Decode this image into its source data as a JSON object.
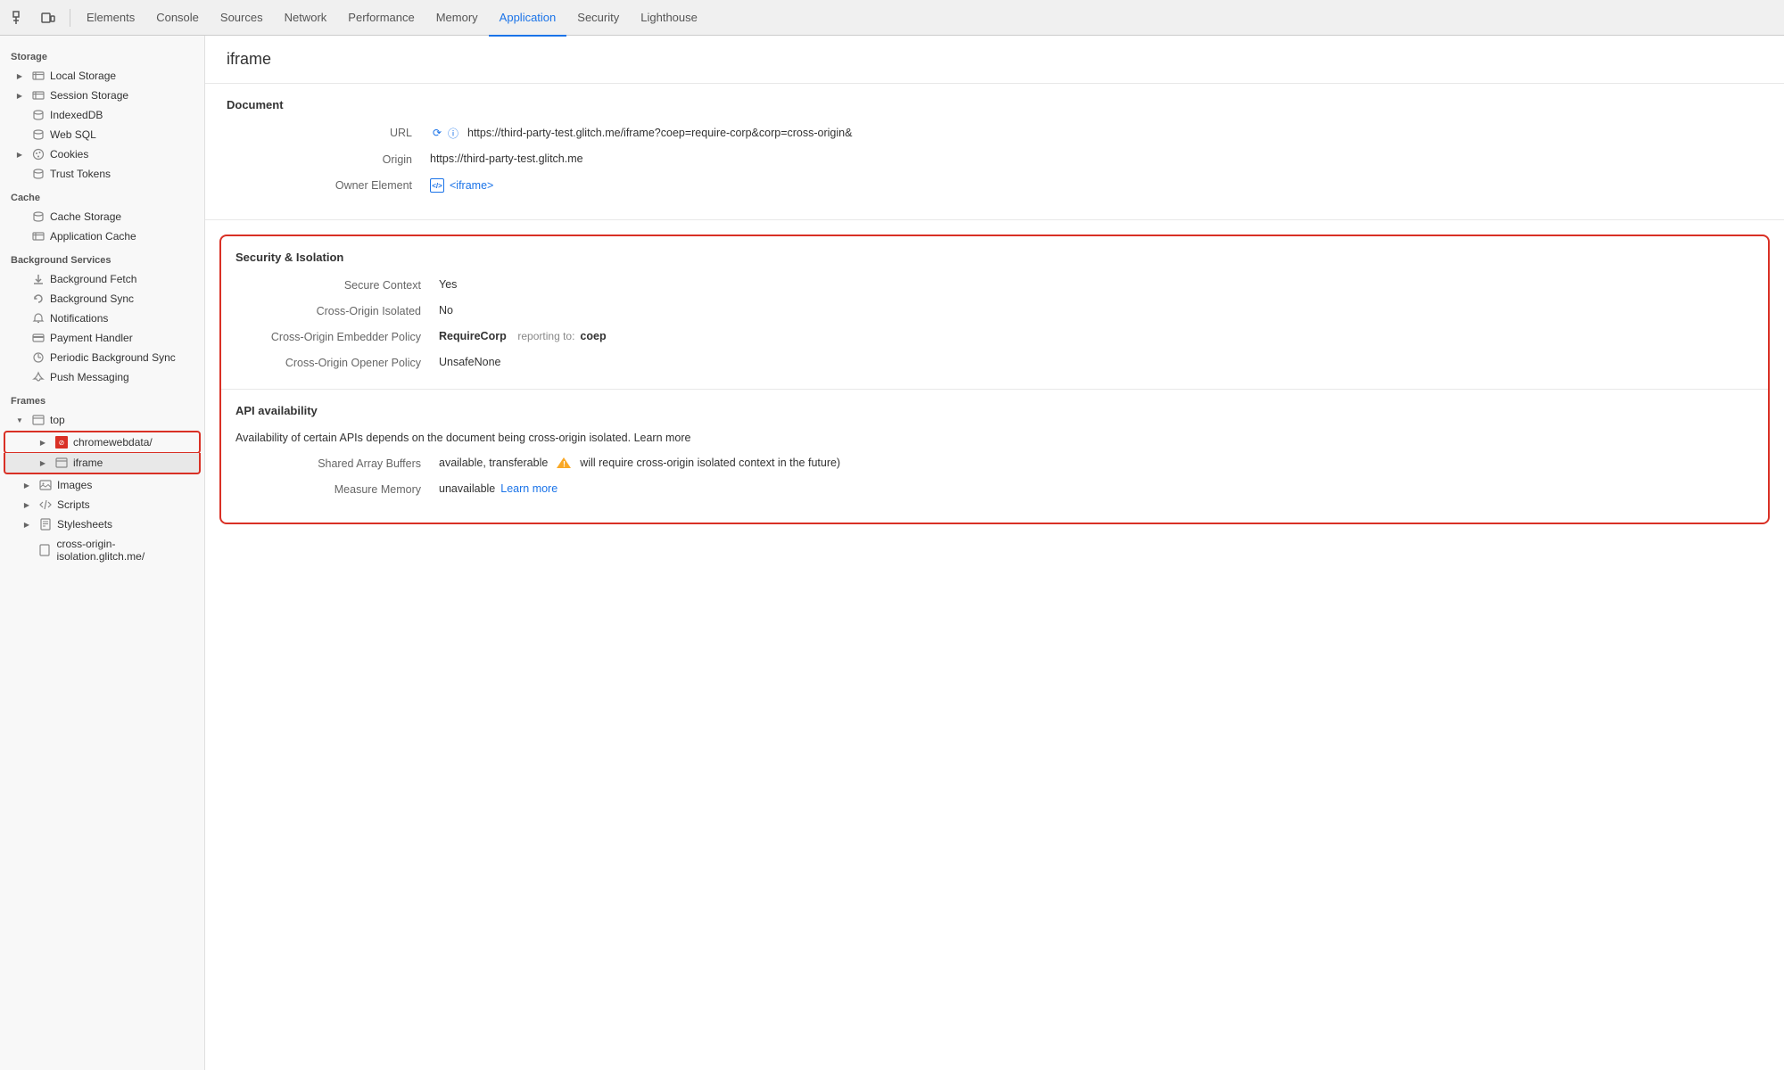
{
  "tabs": [
    {
      "label": "Elements",
      "active": false
    },
    {
      "label": "Console",
      "active": false
    },
    {
      "label": "Sources",
      "active": false
    },
    {
      "label": "Network",
      "active": false
    },
    {
      "label": "Performance",
      "active": false
    },
    {
      "label": "Memory",
      "active": false
    },
    {
      "label": "Application",
      "active": true
    },
    {
      "label": "Security",
      "active": false
    },
    {
      "label": "Lighthouse",
      "active": false
    }
  ],
  "sidebar": {
    "storage_header": "Storage",
    "cache_header": "Cache",
    "bg_services_header": "Background Services",
    "frames_header": "Frames",
    "items": {
      "local_storage": "Local Storage",
      "session_storage": "Session Storage",
      "indexed_db": "IndexedDB",
      "web_sql": "Web SQL",
      "cookies": "Cookies",
      "trust_tokens": "Trust Tokens",
      "cache_storage": "Cache Storage",
      "application_cache": "Application Cache",
      "bg_fetch": "Background Fetch",
      "bg_sync": "Background Sync",
      "notifications": "Notifications",
      "payment_handler": "Payment Handler",
      "periodic_bg_sync": "Periodic Background Sync",
      "push_messaging": "Push Messaging",
      "top": "top",
      "chromewebdata": "chromewebdata/",
      "iframe": "iframe",
      "images": "Images",
      "scripts": "Scripts",
      "stylesheets": "Stylesheets",
      "cross_origin": "cross-origin-isolation.glitch.me/"
    }
  },
  "panel": {
    "title": "iframe",
    "document_section": "Document",
    "url_label": "URL",
    "url_value": "https://third-party-test.glitch.me/iframe?coep=require-corp&corp=cross-origin&",
    "origin_label": "Origin",
    "origin_value": "https://third-party-test.glitch.me",
    "owner_element_label": "Owner Element",
    "owner_element_value": "<iframe>",
    "security_section": "Security & Isolation",
    "secure_context_label": "Secure Context",
    "secure_context_value": "Yes",
    "cross_origin_isolated_label": "Cross-Origin Isolated",
    "cross_origin_isolated_value": "No",
    "coep_label": "Cross-Origin Embedder Policy",
    "coep_value": "RequireCorp",
    "coep_reporting_label": "reporting to:",
    "coep_reporting_value": "coep",
    "coop_label": "Cross-Origin Opener Policy",
    "coop_value": "UnsafeNone",
    "api_section": "API availability",
    "api_desc": "Availability of certain APIs depends on the document being cross-origin isolated.",
    "api_learn_more": "Learn more",
    "shared_array_label": "Shared Array Buffers",
    "shared_array_value": "available, transferable",
    "shared_array_warning": "⚠",
    "shared_array_warning_text": "will require cross-origin isolated context in the future)",
    "measure_memory_label": "Measure Memory",
    "measure_memory_value": "unavailable",
    "measure_memory_learn_more": "Learn more"
  },
  "colors": {
    "active_tab": "#1a73e8",
    "red_border": "#d93025",
    "link_blue": "#1a73e8"
  }
}
